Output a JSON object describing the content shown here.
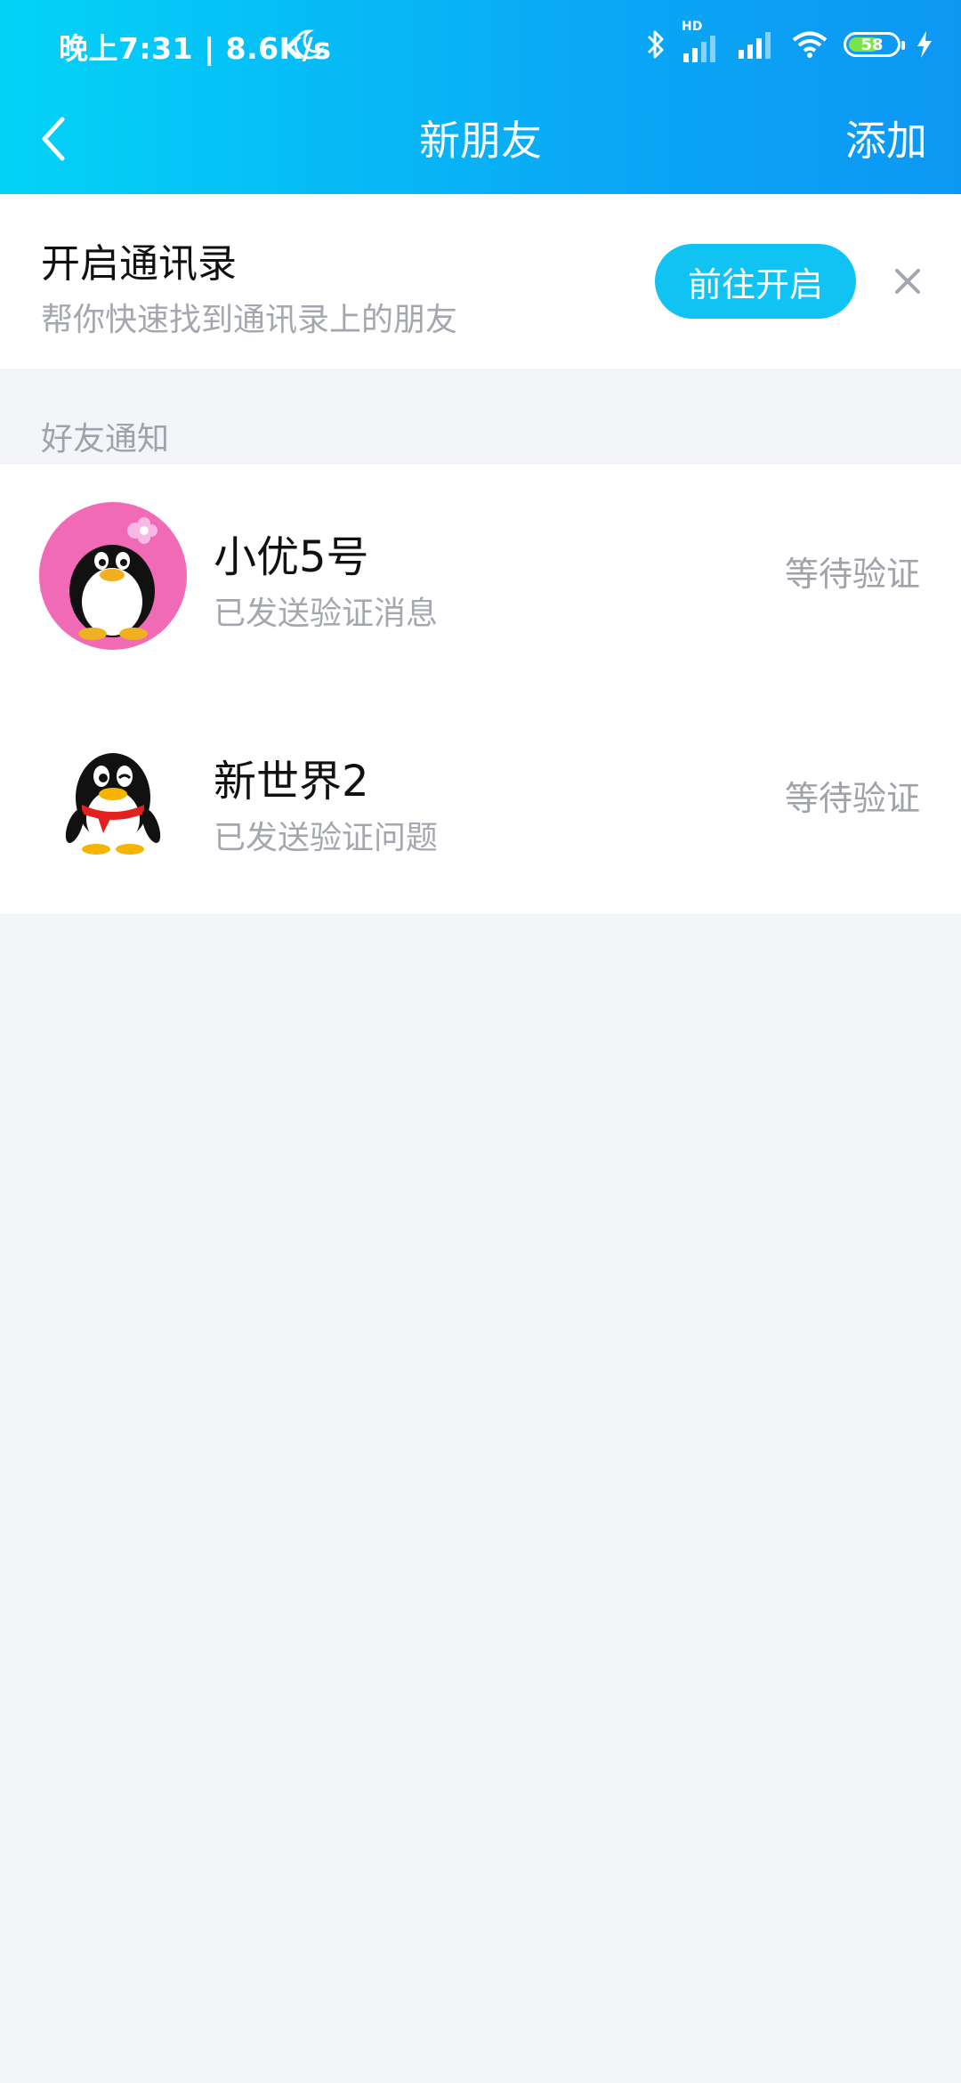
{
  "status_bar": {
    "time_speed": "晚上7:31 | 8.6K/s",
    "hd_label": "HD",
    "battery": "58"
  },
  "nav": {
    "title": "新朋友",
    "action": "添加"
  },
  "contacts_banner": {
    "title": "开启通讯录",
    "subtitle": "帮你快速找到通讯录上的朋友",
    "button": "前往开启"
  },
  "section_label": "好友通知",
  "friends": [
    {
      "name": "小优5号",
      "desc": "已发送验证消息",
      "status": "等待验证",
      "avatar": "pink-penguin-avatar"
    },
    {
      "name": "新世界2",
      "desc": "已发送验证问题",
      "status": "等待验证",
      "avatar": "qq-penguin-avatar"
    }
  ]
}
